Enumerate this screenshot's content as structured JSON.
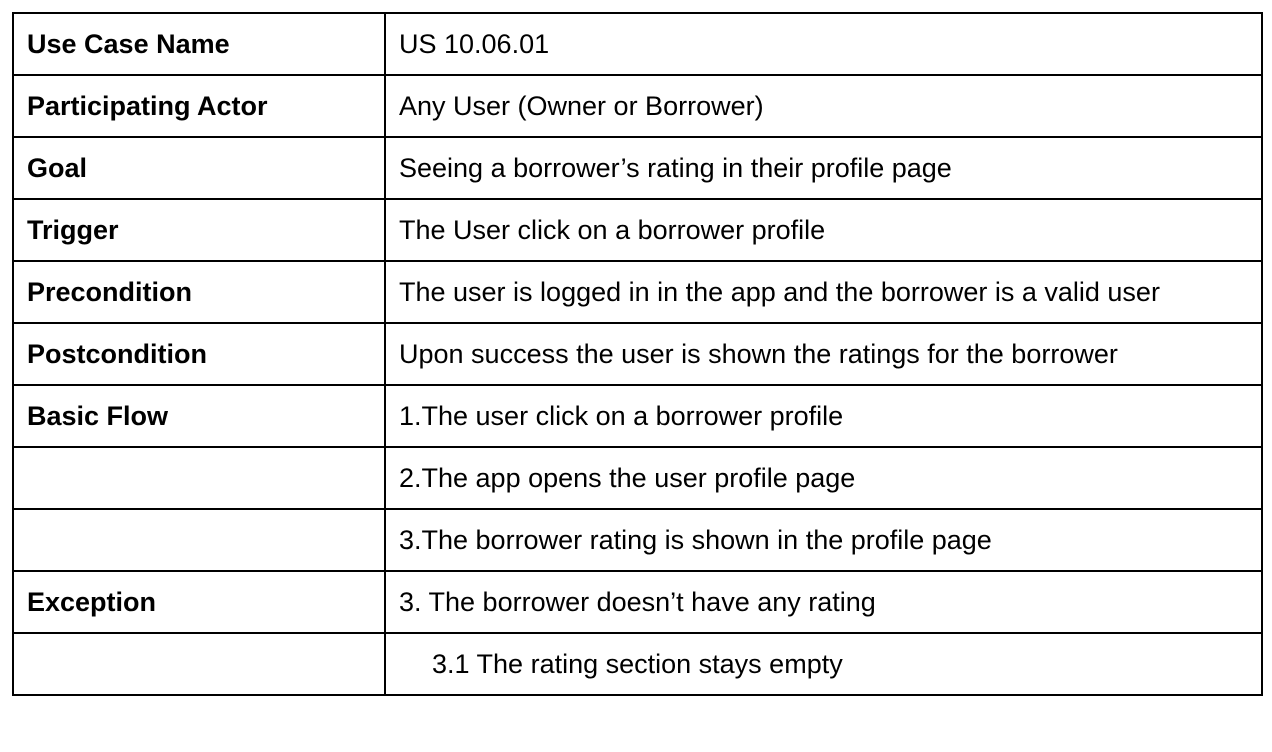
{
  "rows": [
    {
      "label": "Use Case Name",
      "value": "US 10.06.01"
    },
    {
      "label": "Participating Actor",
      "value": "Any User (Owner or Borrower)"
    },
    {
      "label": "Goal",
      "value": "Seeing a borrower’s rating in their profile page"
    },
    {
      "label": "Trigger",
      "value": "The User click on a borrower profile"
    },
    {
      "label": "Precondition",
      "value": "The user is logged in in the app and the borrower is a valid user"
    },
    {
      "label": "Postcondition",
      "value": "Upon success the user is shown the ratings for the borrower"
    },
    {
      "label": "Basic Flow",
      "value": "1.The user click on a borrower profile"
    },
    {
      "label": "",
      "value": "2.The app opens the user profile page"
    },
    {
      "label": "",
      "value": "3.The borrower rating is shown in the profile page"
    },
    {
      "label": "Exception",
      "value": "3. The borrower doesn’t have any rating"
    },
    {
      "label": "",
      "value": "3.1 The rating section stays empty"
    }
  ]
}
